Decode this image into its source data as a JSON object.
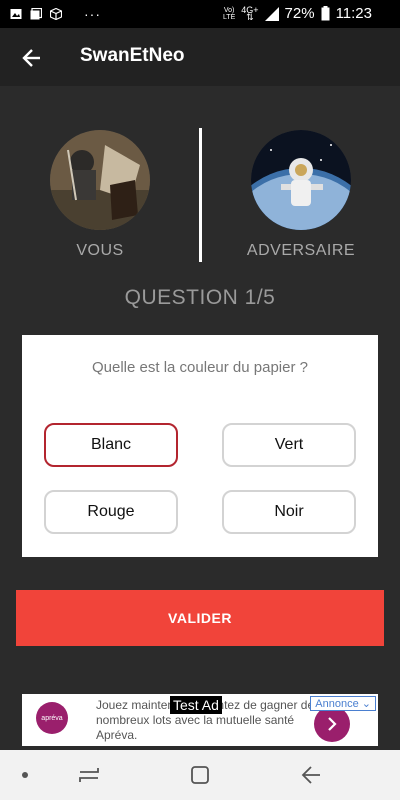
{
  "status_bar": {
    "icons": [
      "image-icon",
      "gallery-icon",
      "cube-icon",
      "more-dots-icon",
      "volte-icon",
      "4g-icon",
      "signal-icon",
      "battery-icon"
    ],
    "more_dots": "···",
    "volte_top": "Vo)",
    "volte_bottom": "LTE",
    "network": "4G+",
    "battery": "72%",
    "time": "11:23"
  },
  "app_bar": {
    "title": "SwanEtNeo"
  },
  "players": {
    "you": {
      "label": "VOUS"
    },
    "opponent": {
      "label": "ADVERSAIRE"
    }
  },
  "question": {
    "counter": "QUESTION 1/5",
    "text": "Quelle est la couleur du papier ?",
    "answers": [
      {
        "label": "Blanc",
        "selected": true
      },
      {
        "label": "Vert",
        "selected": false
      },
      {
        "label": "Rouge",
        "selected": false
      },
      {
        "label": "Noir",
        "selected": false
      }
    ]
  },
  "validate_button": {
    "label": "VALIDER"
  },
  "ad": {
    "overlay": "Test Ad",
    "text": "Jouez maintenant et tentez de gagner de nombreux lots avec la mutuelle santé Apréva.",
    "choice": "Annonce",
    "logo_text": "apréva"
  },
  "colors": {
    "background": "#2b2b2b",
    "accent": "#f1443a",
    "selected_border": "#b3252f",
    "ad_brand": "#9a1f6c"
  }
}
